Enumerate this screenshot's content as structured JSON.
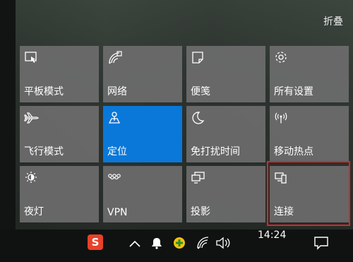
{
  "action_center": {
    "collapse_label": "折叠",
    "tiles": [
      {
        "label": "平板模式",
        "icon": "tablet-mode-icon",
        "active": false
      },
      {
        "label": "网络",
        "icon": "network-icon",
        "active": false
      },
      {
        "label": "便笺",
        "icon": "note-icon",
        "active": false
      },
      {
        "label": "所有设置",
        "icon": "gear-icon",
        "active": false
      },
      {
        "label": "飞行模式",
        "icon": "airplane-icon",
        "active": false
      },
      {
        "label": "定位",
        "icon": "location-icon",
        "active": true
      },
      {
        "label": "免打扰时间",
        "icon": "moon-icon",
        "active": false
      },
      {
        "label": "移动热点",
        "icon": "hotspot-icon",
        "active": false
      },
      {
        "label": "夜灯",
        "icon": "brightness-icon",
        "active": false
      },
      {
        "label": "VPN",
        "icon": "vpn-icon",
        "active": false
      },
      {
        "label": "投影",
        "icon": "project-icon",
        "active": false
      },
      {
        "label": "连接",
        "icon": "connect-icon",
        "active": false
      }
    ]
  },
  "taskbar": {
    "sogou_label": "S",
    "clock": "14:24"
  },
  "colors": {
    "active_tile": "#0a78d8",
    "tile": "#6c6c6c",
    "highlight": "#d9262a"
  }
}
